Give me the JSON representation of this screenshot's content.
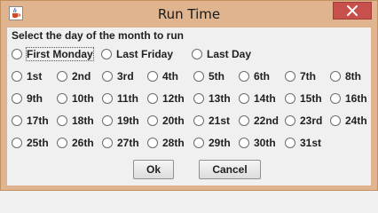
{
  "window": {
    "title": "Run Time",
    "app_icon": "java-cup-icon",
    "close_icon": "close-icon",
    "title_bar_color": "#dfb48e",
    "close_button_color": "#c7504c"
  },
  "dialog": {
    "heading": "Select the day of the month to run",
    "selected": "none",
    "special_options": [
      {
        "label": "First Monday"
      },
      {
        "label": "Last Friday"
      },
      {
        "label": "Last Day"
      }
    ],
    "days": [
      {
        "label": "1st"
      },
      {
        "label": "2nd"
      },
      {
        "label": "3rd"
      },
      {
        "label": "4th"
      },
      {
        "label": "5th"
      },
      {
        "label": "6th"
      },
      {
        "label": "7th"
      },
      {
        "label": "8th"
      },
      {
        "label": "9th"
      },
      {
        "label": "10th"
      },
      {
        "label": "11th"
      },
      {
        "label": "12th"
      },
      {
        "label": "13th"
      },
      {
        "label": "14th"
      },
      {
        "label": "15th"
      },
      {
        "label": "16th"
      },
      {
        "label": "17th"
      },
      {
        "label": "18th"
      },
      {
        "label": "19th"
      },
      {
        "label": "20th"
      },
      {
        "label": "21st"
      },
      {
        "label": "22nd"
      },
      {
        "label": "23rd"
      },
      {
        "label": "24th"
      },
      {
        "label": "25th"
      },
      {
        "label": "26th"
      },
      {
        "label": "27th"
      },
      {
        "label": "28th"
      },
      {
        "label": "29th"
      },
      {
        "label": "30th"
      },
      {
        "label": "31st"
      }
    ],
    "ok_label": "Ok",
    "cancel_label": "Cancel"
  }
}
